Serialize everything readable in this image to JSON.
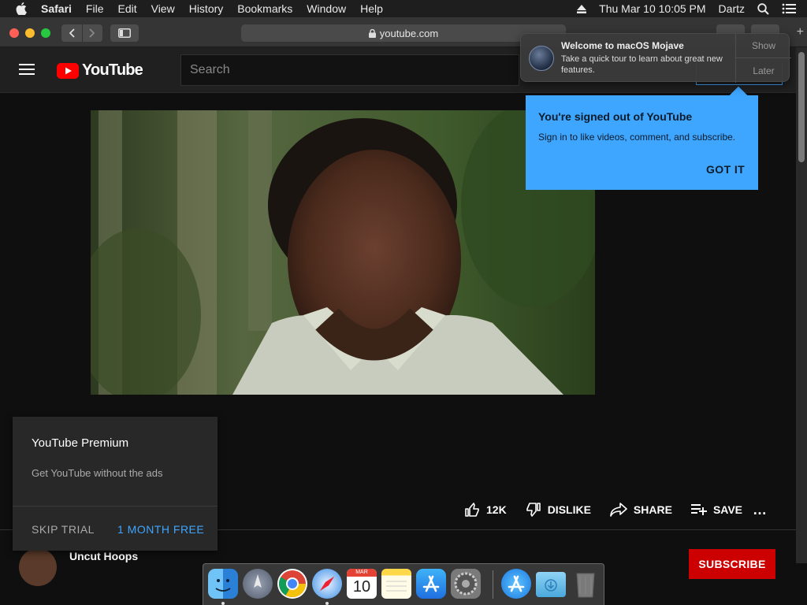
{
  "menubar": {
    "app": "Safari",
    "items": [
      "File",
      "Edit",
      "View",
      "History",
      "Bookmarks",
      "Window",
      "Help"
    ],
    "datetime": "Thu Mar 10  10:05 PM",
    "user": "Dartz"
  },
  "browser": {
    "url": "youtube.com"
  },
  "youtube": {
    "logo_text": "YouTube",
    "search_placeholder": "Search",
    "actions": {
      "likes": "12K",
      "dislike": "DISLIKE",
      "share": "SHARE",
      "save": "SAVE"
    },
    "more": "…",
    "channel_name": "Uncut Hoops",
    "subscribe": "SUBSCRIBE"
  },
  "premium_popup": {
    "title": "YouTube Premium",
    "subtitle": "Get YouTube without the ads",
    "skip": "SKIP TRIAL",
    "free": "1 MONTH FREE"
  },
  "signin_tooltip": {
    "title": "You're signed out of YouTube",
    "body": "Sign in to like videos, comment, and subscribe.",
    "button": "GOT IT"
  },
  "notification": {
    "title": "Welcome to macOS Mojave",
    "body": "Take a quick tour to learn about great new features.",
    "show": "Show",
    "later": "Later"
  },
  "dock": {
    "calendar_month": "MAR",
    "calendar_day": "10",
    "apps": [
      "finder-icon",
      "launchpad-icon",
      "chrome-icon",
      "safari-icon",
      "calendar-icon",
      "notes-icon",
      "app-store-icon",
      "system-preferences-icon",
      "app-store-downloads-icon",
      "downloads-folder-icon",
      "trash-icon"
    ]
  },
  "colors": {
    "accent": "#3ea6ff",
    "youtube_red": "#ff0000",
    "subscribe_red": "#cc0000"
  }
}
